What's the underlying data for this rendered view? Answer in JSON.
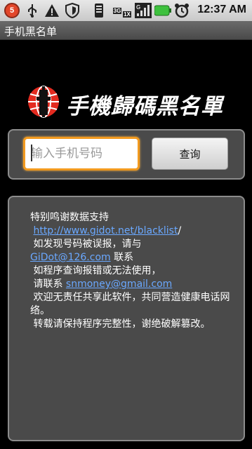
{
  "status_bar": {
    "notification_count": "5",
    "network_3g": "3G",
    "network_1x": "1X",
    "signal_label": "G",
    "time": "12:37 AM"
  },
  "app": {
    "title": "手机黑名单"
  },
  "logo": {
    "text": "手機歸碼黑名單"
  },
  "search": {
    "placeholder": "输入手机号码",
    "button_label": "查询"
  },
  "info": {
    "line1": "特别鸣谢数据支持",
    "link1": "http://www.gidot.net/blacklist",
    "link1_suffix": "/",
    "line2": " 如发现号码被误报，请与",
    "link2": "GiDot@126.com",
    "link2_suffix": " 联系",
    "line3": " 如程序查询报错或无法使用，",
    "line4_prefix": " 请联系 ",
    "link3": "snmoney@gmail.com",
    "line5": " 欢迎无责任共享此软件，共同营造健康电话网络。",
    "line6": " 转载请保持程序完整性，谢绝破解篡改。"
  },
  "colors": {
    "accent_focus": "#f29a1f",
    "link": "#6aa8ff",
    "panel": "#4a4a4a"
  }
}
